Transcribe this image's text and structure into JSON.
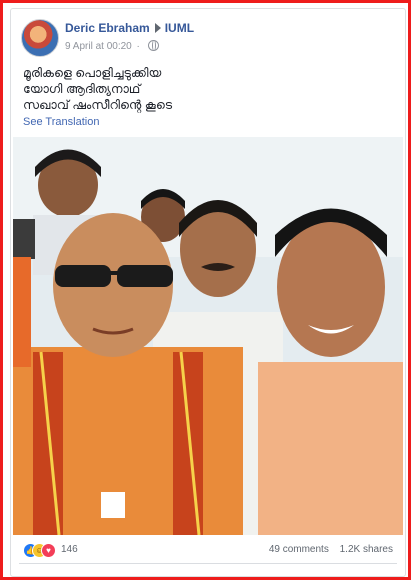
{
  "post": {
    "author": "Deric Ebraham",
    "group": "IUML",
    "timestamp": "9 April at 00:20",
    "text_lines": [
      "മൂരികളെ പൊളിച്ചടുക്കിയ",
      "യോഗി ആദിത്യനാഥ്",
      "സഖാവ് ഷംസീറിന്റെ കൂടെ"
    ],
    "see_translation": "See Translation"
  },
  "engagement": {
    "reaction_count": "146",
    "comments": "49 comments",
    "shares": "1.2K shares",
    "reactions": [
      "like",
      "haha",
      "love"
    ]
  },
  "colors": {
    "border_accent": "#ee1c1c",
    "link": "#365899",
    "meta": "#90949c"
  }
}
